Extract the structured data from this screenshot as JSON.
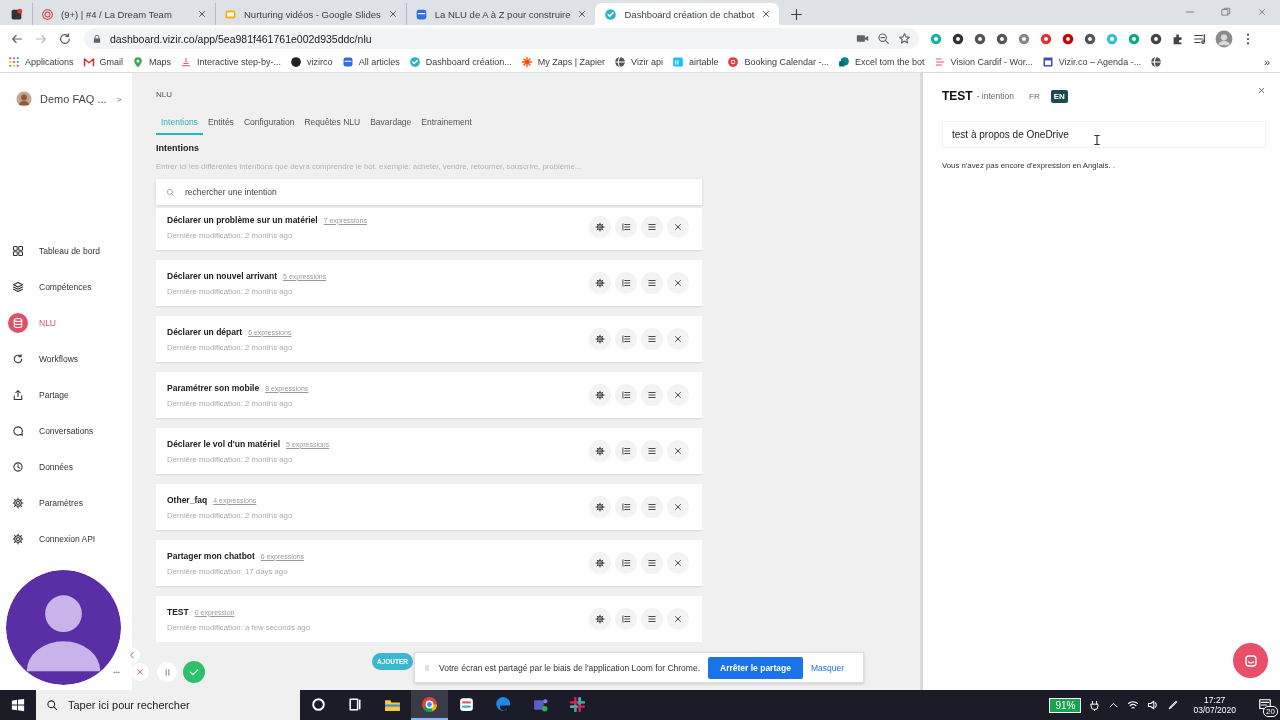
{
  "browser": {
    "tabs": [
      {
        "title": "(9+) | #4 / La Dream Team",
        "selected": false
      },
      {
        "title": "Nurturing vidéos - Google Slides",
        "selected": false
      },
      {
        "title": "La NLU de A à Z pour construire",
        "selected": false
      },
      {
        "title": "Dashboard création de chatbot",
        "selected": true
      }
    ],
    "address": "dashboard.vizir.co/app/5ea981f461761e002d935ddc/nlu",
    "bookmarks": [
      {
        "label": "Applications"
      },
      {
        "label": "Gmail"
      },
      {
        "label": "Maps"
      },
      {
        "label": "Interactive step-by-..."
      },
      {
        "label": "vizirco"
      },
      {
        "label": "All articles"
      },
      {
        "label": "Dashboard création..."
      },
      {
        "label": "My Zaps | Zapier"
      },
      {
        "label": "Vizir api"
      },
      {
        "label": "airtable"
      },
      {
        "label": "Booking Calendar -..."
      },
      {
        "label": "Excel tom the bot"
      },
      {
        "label": "Vision Cardif - Wor..."
      },
      {
        "label": "Vizir.co – Agenda -..."
      }
    ],
    "bookmarks_more": "»"
  },
  "sidebar": {
    "bot_name": "Demo FAQ ...",
    "bot_chevron": ">",
    "items": [
      {
        "label": "Tableau de bord",
        "selected": false
      },
      {
        "label": "Compétences",
        "selected": false
      },
      {
        "label": "NLU",
        "selected": true
      },
      {
        "label": "Workflows",
        "selected": false
      },
      {
        "label": "Partage",
        "selected": false
      },
      {
        "label": "Conversations",
        "selected": false
      },
      {
        "label": "Données",
        "selected": false
      },
      {
        "label": "Paramètres",
        "selected": false
      },
      {
        "label": "Connexion API",
        "selected": false
      }
    ]
  },
  "main": {
    "breadcrumb": "NLU",
    "tabs": [
      {
        "label": "Intentions",
        "selected": true
      },
      {
        "label": "Entités",
        "selected": false
      },
      {
        "label": "Configuration",
        "selected": false
      },
      {
        "label": "Requêtes NLU",
        "selected": false
      },
      {
        "label": "Bavardage",
        "selected": false
      },
      {
        "label": "Entrainement",
        "selected": false
      }
    ],
    "heading": "Intentions",
    "description": "Entrer ici les différentes intentions que devra comprendre le bot. exemple: acheter, vendre, retourner, souscrire, problème...",
    "search_placeholder": "rechercher une intention",
    "intentions": [
      {
        "title": "Déclarer un problème sur un matériel",
        "expressions": "7 expressions",
        "modified": "Dernière modification: 2 months ago"
      },
      {
        "title": "Déclarer un nouvel arrivant",
        "expressions": "5 expressions",
        "modified": "Dernière modification: 2 months ago"
      },
      {
        "title": "Déclarer un départ",
        "expressions": "6 expressions",
        "modified": "Dernière modification: 2 months ago"
      },
      {
        "title": "Paramétrer son mobile",
        "expressions": "8 expressions",
        "modified": "Dernière modification: 2 months ago"
      },
      {
        "title": "Déclarer le vol d'un matériel",
        "expressions": "5 expressions",
        "modified": "Dernière modification: 2 months ago"
      },
      {
        "title": "Other_faq",
        "expressions": "4 expressions",
        "modified": "Dernière modification: 2 months ago"
      },
      {
        "title": "Partager mon chatbot",
        "expressions": "6 expressions",
        "modified": "Dernière modification: 17 days ago"
      },
      {
        "title": "TEST",
        "expressions": "0 expression",
        "modified": "Dernière modification: a few seconds ago"
      }
    ],
    "add_button": "AJOUTER"
  },
  "panel": {
    "title": "TEST",
    "subtitle": "- intention",
    "languages": [
      {
        "label": "FR",
        "selected": false
      },
      {
        "label": "EN",
        "selected": true
      }
    ],
    "expression_value": "test à propos de OneDrive",
    "empty_message": "Vous n'avez pas encore d'expression en Anglais. ."
  },
  "loom": {
    "message": "Votre écran est partagé par le biais de l'application Loom for Chrome.",
    "stop_button": "Arrêter le partage",
    "hide_link": "Masquer"
  },
  "taskbar": {
    "search_placeholder": "Taper ici pour rechercher",
    "apps": [
      {
        "selected": false
      },
      {
        "selected": false
      },
      {
        "selected": false
      },
      {
        "selected": true
      },
      {
        "selected": false
      },
      {
        "selected": false
      },
      {
        "selected": false
      },
      {
        "selected": false
      }
    ],
    "battery": "91%",
    "time": "17:27",
    "date": "03/07/2020",
    "notifications": "20"
  }
}
